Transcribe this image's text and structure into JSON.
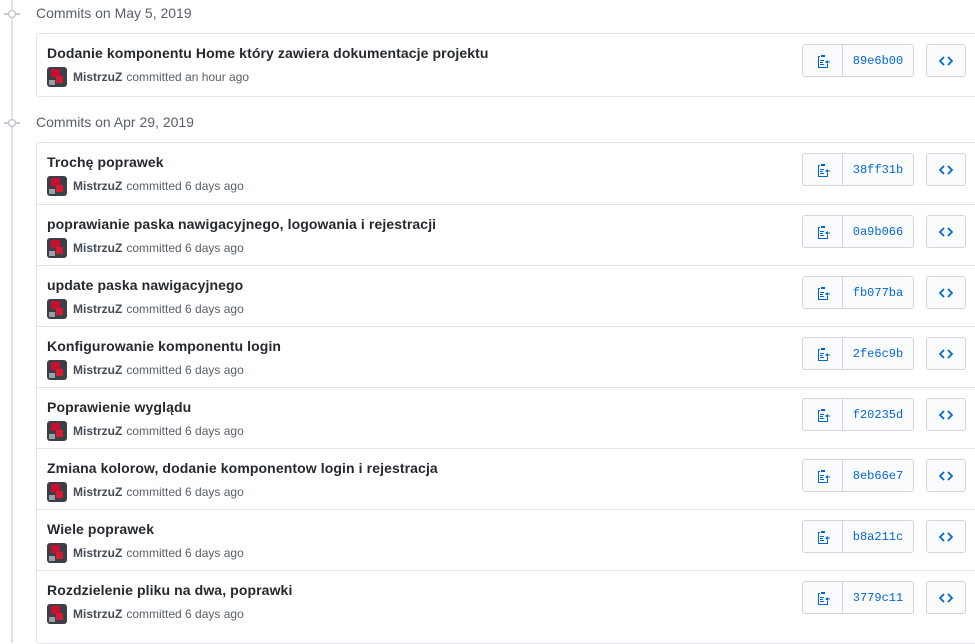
{
  "colors": {
    "accent": "#0366d6",
    "muted": "#586069",
    "border": "#e1e4e8"
  },
  "icons": {
    "node": "git-commit-icon",
    "copy": "clippy-icon",
    "browse": "code-icon"
  },
  "groups": [
    {
      "title": "Commits on May 5, 2019",
      "commits": [
        {
          "message": "Dodanie komponentu Home który zawiera dokumentacje projektu",
          "author": "MistrzuZ",
          "when": "committed an hour ago",
          "sha": "89e6b00"
        }
      ]
    },
    {
      "title": "Commits on Apr 29, 2019",
      "commits": [
        {
          "message": "Trochę poprawek",
          "author": "MistrzuZ",
          "when": "committed 6 days ago",
          "sha": "38ff31b"
        },
        {
          "message": "poprawianie paska nawigacyjnego, logowania i rejestracji",
          "author": "MistrzuZ",
          "when": "committed 6 days ago",
          "sha": "0a9b066"
        },
        {
          "message": "update paska nawigacyjnego",
          "author": "MistrzuZ",
          "when": "committed 6 days ago",
          "sha": "fb077ba"
        },
        {
          "message": "Konfigurowanie komponentu login",
          "author": "MistrzuZ",
          "when": "committed 6 days ago",
          "sha": "2fe6c9b"
        },
        {
          "message": "Poprawienie wyglądu",
          "author": "MistrzuZ",
          "when": "committed 6 days ago",
          "sha": "f20235d"
        },
        {
          "message": "Zmiana kolorow, dodanie komponentow login i rejestracja",
          "author": "MistrzuZ",
          "when": "committed 6 days ago",
          "sha": "8eb66e7"
        },
        {
          "message": "Wiele poprawek",
          "author": "MistrzuZ",
          "when": "committed 6 days ago",
          "sha": "b8a211c"
        },
        {
          "message": "Rozdzielenie pliku na dwa, poprawki",
          "author": "MistrzuZ",
          "when": "committed 6 days ago",
          "sha": "3779c11"
        }
      ]
    }
  ]
}
